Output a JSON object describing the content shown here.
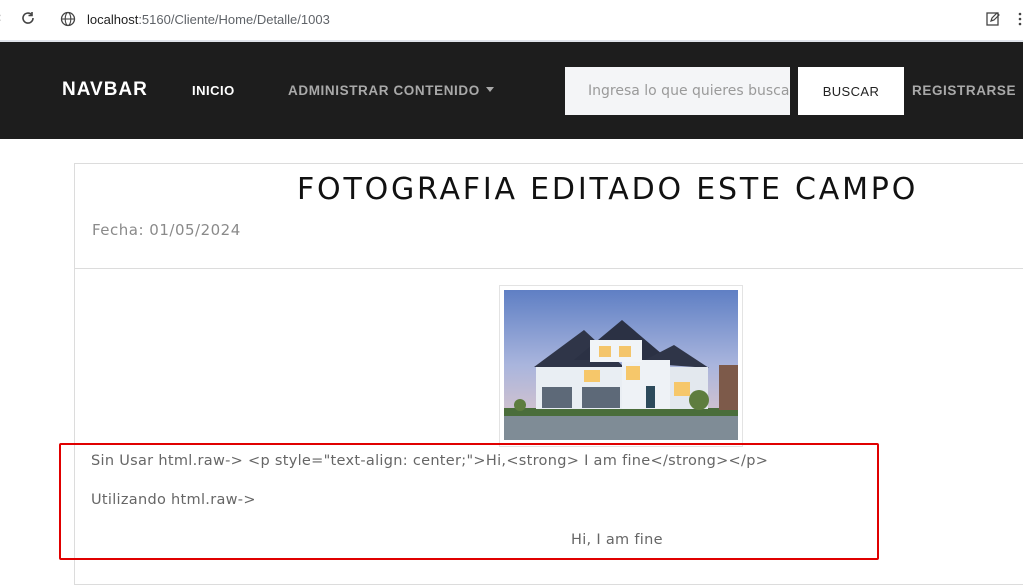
{
  "browser": {
    "url_host": "localhost",
    "url_rest": ":5160/Cliente/Home/Detalle/1003"
  },
  "navbar": {
    "brand": "NAVBAR",
    "items": [
      {
        "label": "INICIO"
      },
      {
        "label": "ADMINISTRAR CONTENIDO"
      }
    ],
    "search": {
      "placeholder": "Ingresa lo que quieres buscar",
      "value": ""
    },
    "search_button": "BUSCAR",
    "register": "REGISTRARSE"
  },
  "article": {
    "title": "FOTOGRAFIA EDITADO ESTE CAMPO",
    "date": "Fecha: 01/05/2024",
    "image_alt": "house-photo",
    "content_raw": "Sin Usar html.raw-> <p style=\"text-align: center;\">Hi,<strong> I am fine</strong></p>",
    "content_label": "Utilizando html.raw->",
    "content_rendered": "Hi, I am fine"
  },
  "colors": {
    "navbar_bg": "#1d1d1d",
    "highlight": "#e00000"
  }
}
